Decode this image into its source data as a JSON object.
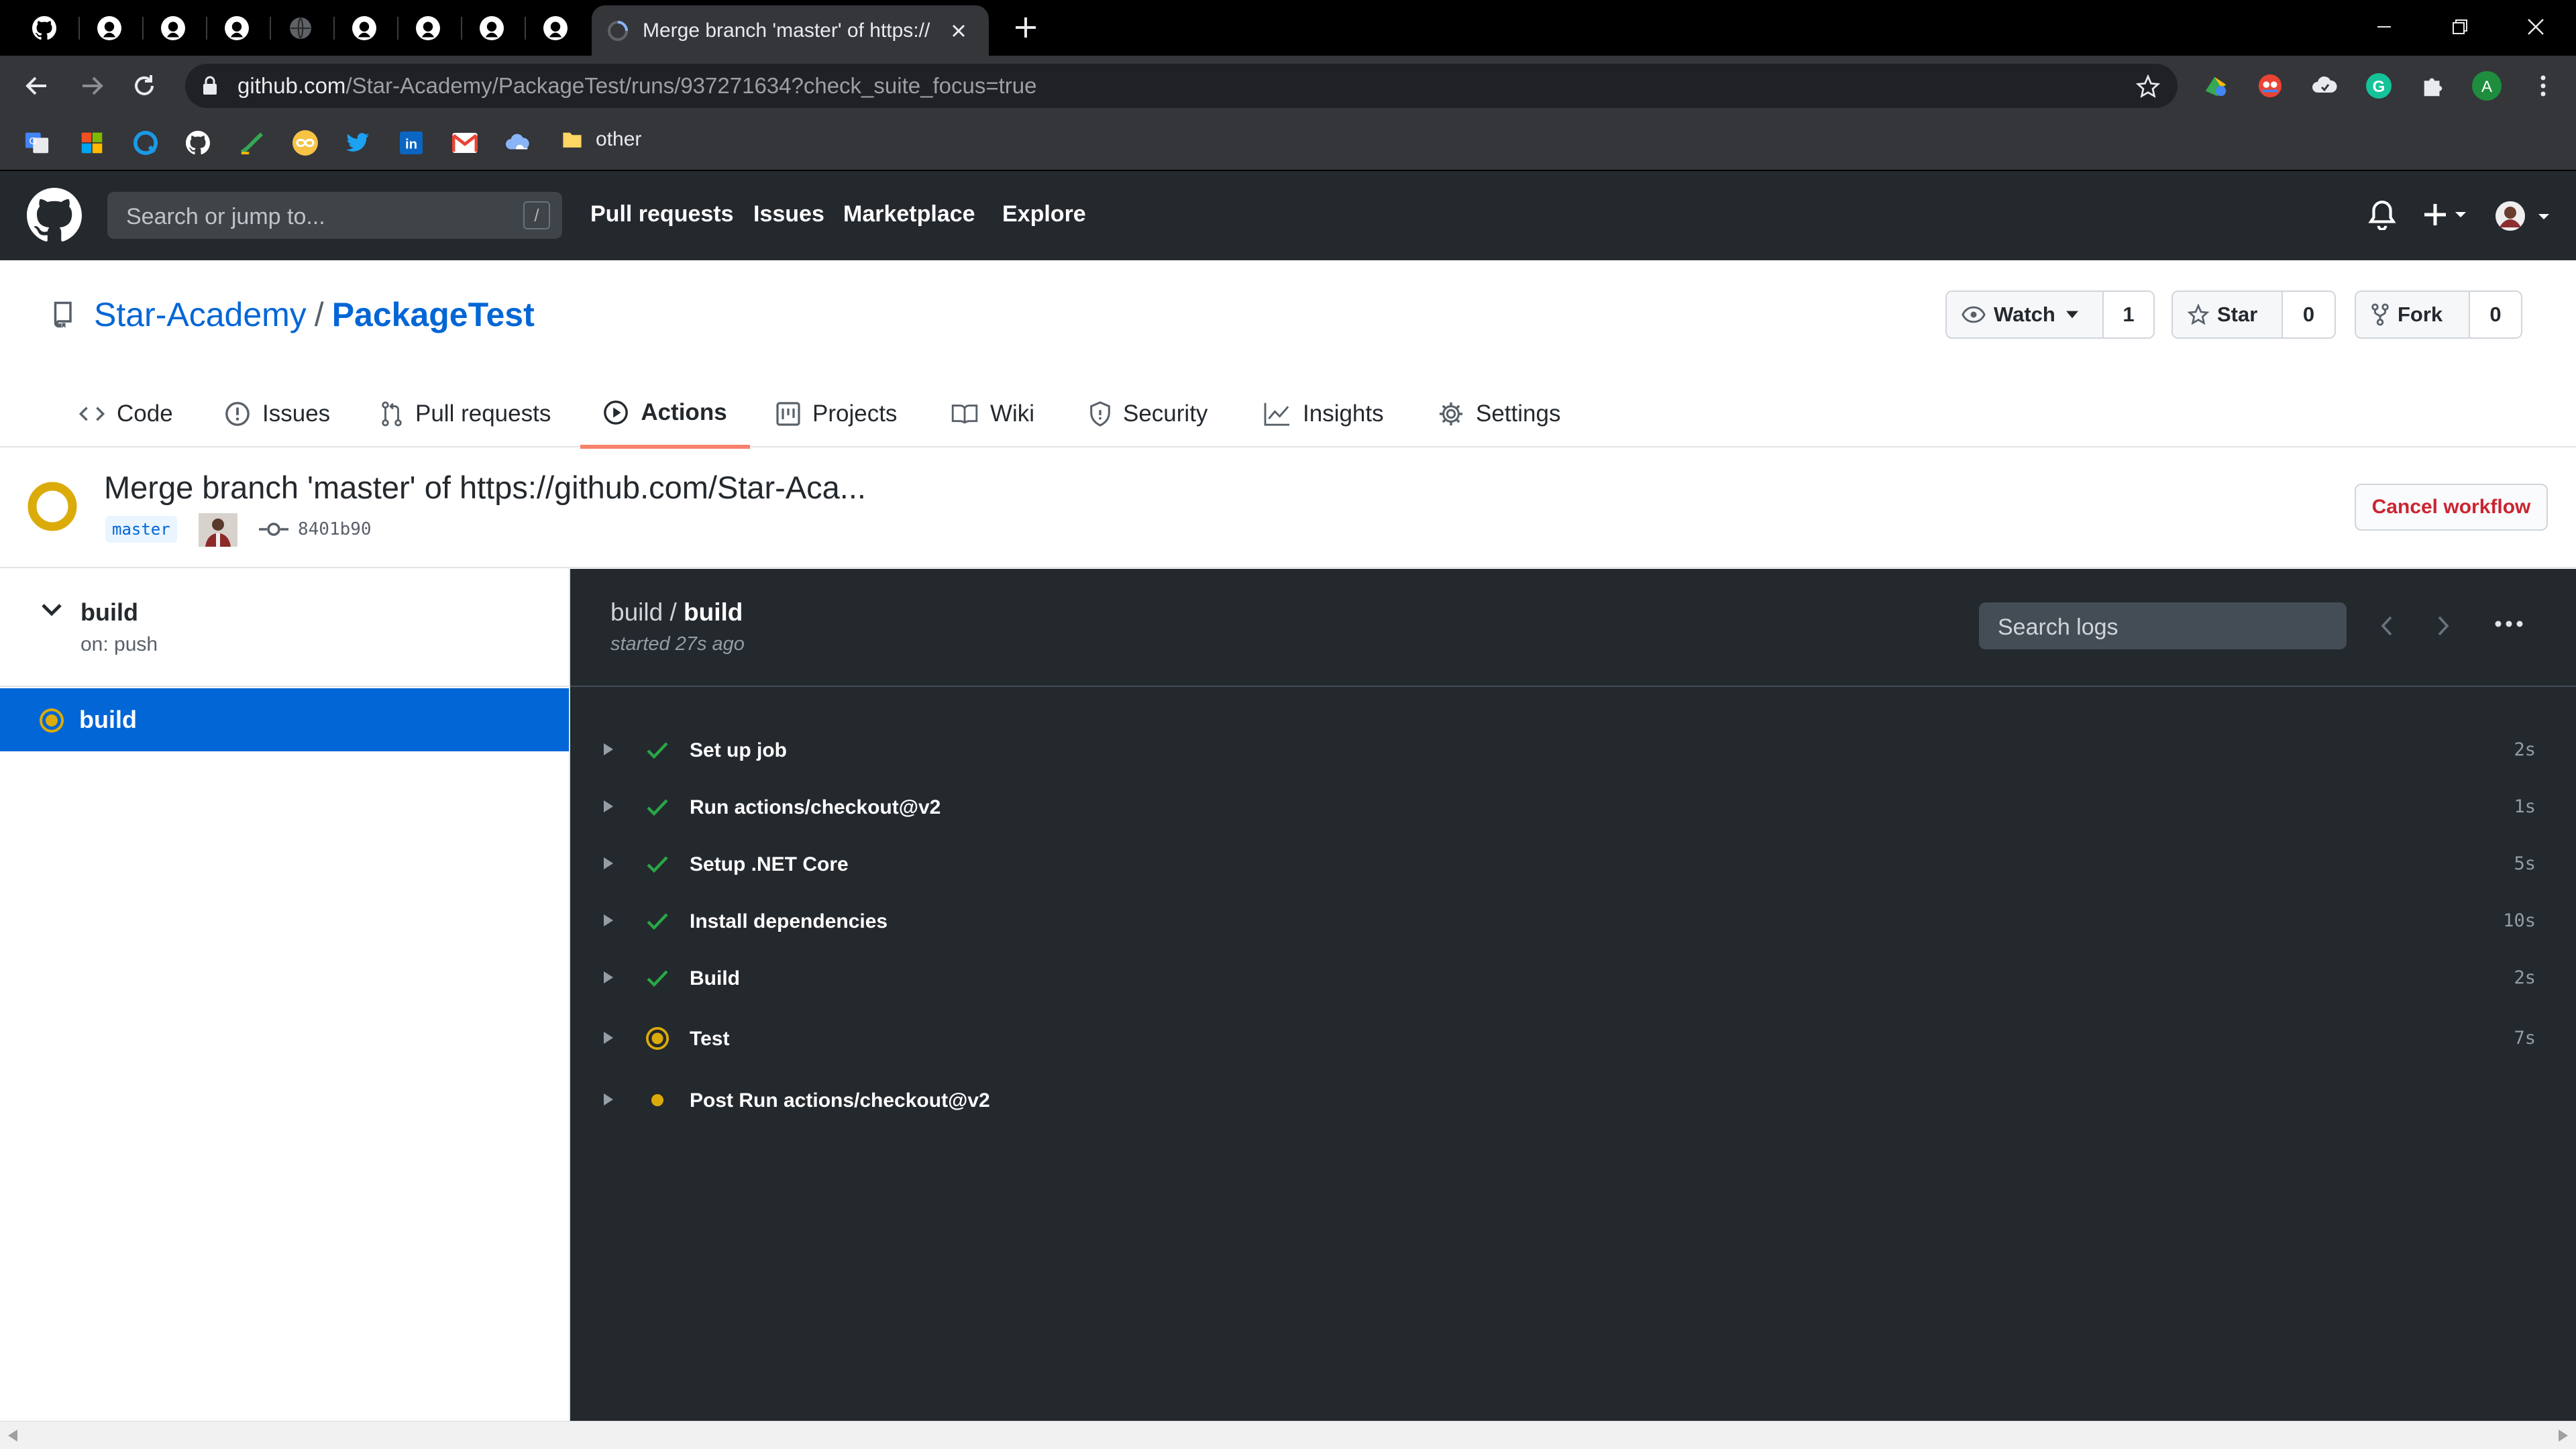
{
  "browser": {
    "active_tab_title": "Merge branch 'master' of https://",
    "url_host": "github.com",
    "url_path": "/Star-Academy/PackageTest/runs/937271634?check_suite_focus=true",
    "profile_initial": "A",
    "bookmark_folder": "other"
  },
  "github": {
    "search_placeholder": "Search or jump to...",
    "search_shortcut": "/",
    "nav": [
      "Pull requests",
      "Issues",
      "Marketplace",
      "Explore"
    ]
  },
  "repo": {
    "owner": "Star-Academy",
    "separator": "/",
    "name": "PackageTest",
    "watch_label": "Watch",
    "watch_count": "1",
    "star_label": "Star",
    "star_count": "0",
    "fork_label": "Fork",
    "fork_count": "0",
    "tabs": [
      "Code",
      "Issues",
      "Pull requests",
      "Actions",
      "Projects",
      "Wiki",
      "Security",
      "Insights",
      "Settings"
    ],
    "active_tab": "Actions"
  },
  "run": {
    "title": "Merge branch 'master' of https://github.com/Star-Aca...",
    "branch": "master",
    "commit_sha": "8401b90",
    "cancel_label": "Cancel workflow",
    "status_color": "#dbab09"
  },
  "sidebar": {
    "workflow_name": "build",
    "workflow_trigger": "on: push",
    "job_name": "build"
  },
  "log": {
    "crumb_workflow": "build",
    "crumb_sep": " / ",
    "crumb_job": "build",
    "started": "started 27s ago",
    "search_placeholder": "Search logs",
    "steps": [
      {
        "name": "Set up job",
        "status": "success",
        "duration": "2s"
      },
      {
        "name": "Run actions/checkout@v2",
        "status": "success",
        "duration": "1s"
      },
      {
        "name": "Setup .NET Core",
        "status": "success",
        "duration": "5s"
      },
      {
        "name": "Install dependencies",
        "status": "success",
        "duration": "10s"
      },
      {
        "name": "Build",
        "status": "success",
        "duration": "2s"
      },
      {
        "name": "Test",
        "status": "in_progress",
        "duration": "7s"
      },
      {
        "name": "Post Run actions/checkout@v2",
        "status": "queued",
        "duration": ""
      }
    ]
  },
  "colors": {
    "success": "#28a745",
    "in_progress": "#dbab09",
    "link": "#0366d6",
    "danger": "#cb2431",
    "tab_underline": "#f9826c"
  }
}
